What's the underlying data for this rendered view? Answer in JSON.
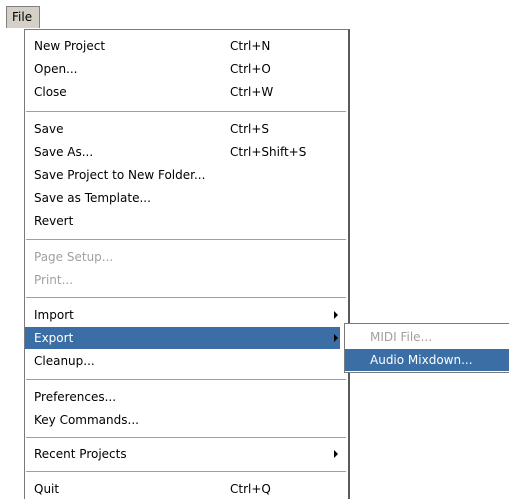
{
  "menubar": {
    "title": "File"
  },
  "menu": {
    "items": [
      {
        "label": "New Project",
        "shortcut": "Ctrl+N"
      },
      {
        "label": "Open...",
        "shortcut": "Ctrl+O"
      },
      {
        "label": "Close",
        "shortcut": "Ctrl+W"
      },
      {
        "label": "Save",
        "shortcut": "Ctrl+S"
      },
      {
        "label": "Save As...",
        "shortcut": "Ctrl+Shift+S"
      },
      {
        "label": "Save Project to New Folder..."
      },
      {
        "label": "Save as Template..."
      },
      {
        "label": "Revert"
      },
      {
        "label": "Page Setup...",
        "disabled": true
      },
      {
        "label": "Print...",
        "disabled": true
      },
      {
        "label": "Import",
        "submenu": true
      },
      {
        "label": "Export",
        "submenu": true,
        "selected": true
      },
      {
        "label": "Cleanup..."
      },
      {
        "label": "Preferences..."
      },
      {
        "label": "Key Commands..."
      },
      {
        "label": "Recent Projects",
        "submenu": true
      },
      {
        "label": "Quit",
        "shortcut": "Ctrl+Q"
      }
    ]
  },
  "export_submenu": {
    "items": [
      {
        "label": "MIDI File...",
        "disabled": true
      },
      {
        "label": "Audio Mixdown...",
        "selected": true
      }
    ]
  },
  "colors": {
    "selection_bg": "#3a6ea5",
    "disabled_text": "#a0a0a0",
    "menubar_bg": "#d4d0c8"
  }
}
